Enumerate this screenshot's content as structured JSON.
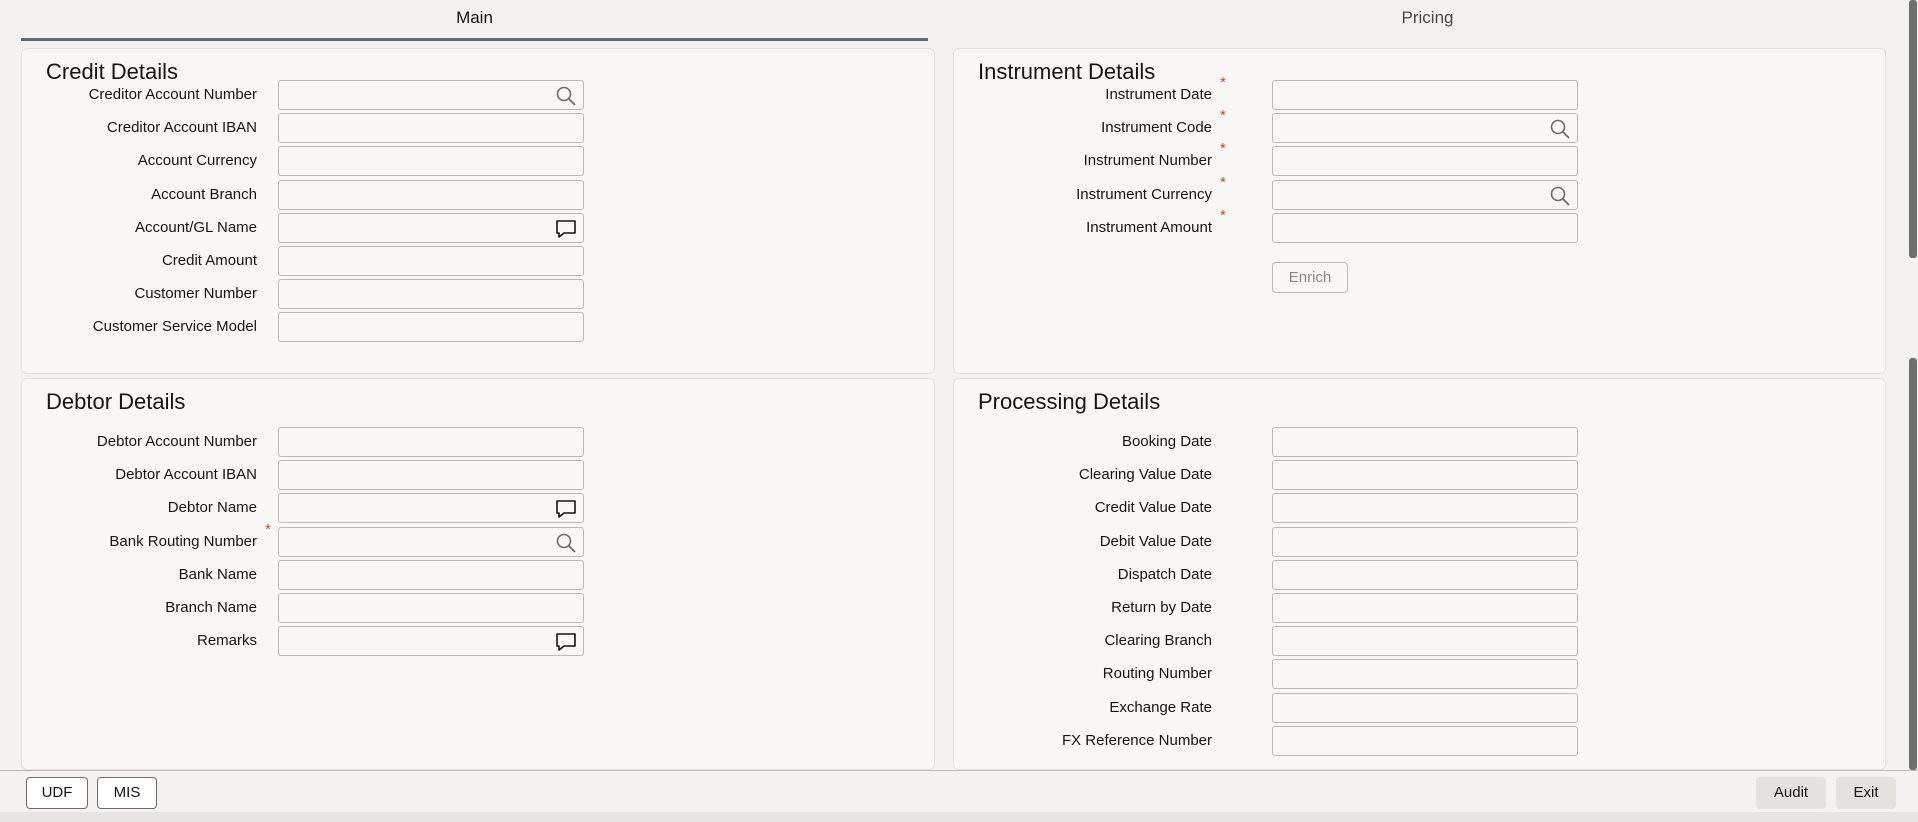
{
  "tabs": {
    "main": "Main",
    "pricing": "Pricing"
  },
  "credit": {
    "title": "Credit Details",
    "fields": [
      {
        "label": "Creditor Account Number",
        "value": "",
        "icon": "search-icon"
      },
      {
        "label": "Creditor Account IBAN",
        "value": ""
      },
      {
        "label": "Account Currency",
        "value": ""
      },
      {
        "label": "Account Branch",
        "value": ""
      },
      {
        "label": "Account/GL Name",
        "value": "",
        "icon": "comment-icon"
      },
      {
        "label": "Credit Amount",
        "value": ""
      },
      {
        "label": "Customer Number",
        "value": ""
      },
      {
        "label": "Customer Service Model",
        "value": ""
      }
    ]
  },
  "debtor": {
    "title": "Debtor Details",
    "fields": [
      {
        "label": "Debtor Account Number",
        "value": ""
      },
      {
        "label": "Debtor Account IBAN",
        "value": ""
      },
      {
        "label": "Debtor Name",
        "value": "",
        "icon": "comment-icon"
      },
      {
        "label": "Bank Routing Number",
        "value": "",
        "icon": "search-icon",
        "required": true
      },
      {
        "label": "Bank Name",
        "value": ""
      },
      {
        "label": "Branch Name",
        "value": ""
      },
      {
        "label": "Remarks",
        "value": "",
        "icon": "comment-icon"
      }
    ]
  },
  "instrument": {
    "title": "Instrument Details",
    "fields": [
      {
        "label": "Instrument Date",
        "value": "",
        "required": true
      },
      {
        "label": "Instrument Code",
        "value": "",
        "icon": "search-icon",
        "required": true
      },
      {
        "label": "Instrument Number",
        "value": "",
        "required": true
      },
      {
        "label": "Instrument Currency",
        "value": "",
        "icon": "search-icon",
        "required": true
      },
      {
        "label": "Instrument Amount",
        "value": "",
        "required": true
      }
    ],
    "enrich_label": "Enrich"
  },
  "processing": {
    "title": "Processing Details",
    "fields": [
      {
        "label": "Booking Date",
        "value": ""
      },
      {
        "label": "Clearing Value Date",
        "value": ""
      },
      {
        "label": "Credit Value Date",
        "value": ""
      },
      {
        "label": "Debit Value Date",
        "value": ""
      },
      {
        "label": "Dispatch Date",
        "value": ""
      },
      {
        "label": "Return by Date",
        "value": ""
      },
      {
        "label": "Clearing Branch",
        "value": ""
      },
      {
        "label": "Routing Number",
        "value": ""
      },
      {
        "label": "Exchange Rate",
        "value": ""
      },
      {
        "label": "FX Reference Number",
        "value": ""
      }
    ]
  },
  "required_marker": "*",
  "footer": {
    "udf": "UDF",
    "mis": "MIS",
    "audit": "Audit",
    "exit": "Exit"
  },
  "colors": {
    "required": "#c74634",
    "tab_underline": "#5f6b7a",
    "panel_bg": "#f8f7f5"
  }
}
